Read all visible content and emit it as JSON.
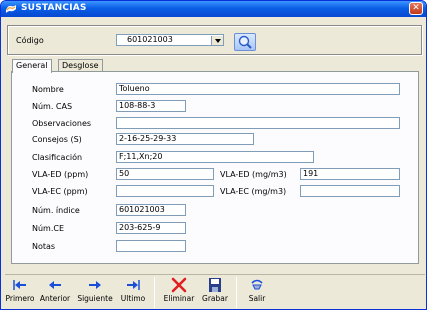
{
  "window": {
    "title": "SUSTANCIAS"
  },
  "search": {
    "codigo_label": "Código",
    "codigo_value": "601021003"
  },
  "tabs": [
    {
      "label": "General"
    },
    {
      "label": "Desglose"
    }
  ],
  "form": {
    "nombre": {
      "label": "Nombre",
      "value": "Tolueno"
    },
    "num_cas": {
      "label": "Núm. CAS",
      "value": "108-88-3"
    },
    "observaciones": {
      "label": "Observaciones",
      "value": ""
    },
    "consejos": {
      "label": "Consejos (S)",
      "value": "2-16-25-29-33"
    },
    "clasificacion": {
      "label": "Clasificación",
      "value": "F;11,Xn;20"
    },
    "vla_ed_ppm": {
      "label": "VLA-ED (ppm)",
      "value": "50"
    },
    "vla_ed_mg": {
      "label": "VLA-ED  (mg/m3)",
      "value": "191"
    },
    "vla_ec_ppm": {
      "label": "VLA-EC (ppm)",
      "value": ""
    },
    "vla_ec_mg": {
      "label": "VLA-EC  (mg/m3)",
      "value": ""
    },
    "num_indice": {
      "label": "Núm. índice",
      "value": "601021003"
    },
    "num_ce": {
      "label": "Núm.CE",
      "value": "203-625-9"
    },
    "notas": {
      "label": "Notas",
      "value": ""
    }
  },
  "toolbar": {
    "primero": "Primero",
    "anterior": "Anterior",
    "siguiente": "Siguiente",
    "ultimo": "Ultimo",
    "eliminar": "Eliminar",
    "grabar": "Grabar",
    "salir": "Salir"
  },
  "colors": {
    "titlebar": "#0a5fe6",
    "nav_arrow": "#1b4fd8",
    "delete": "#e02020"
  }
}
